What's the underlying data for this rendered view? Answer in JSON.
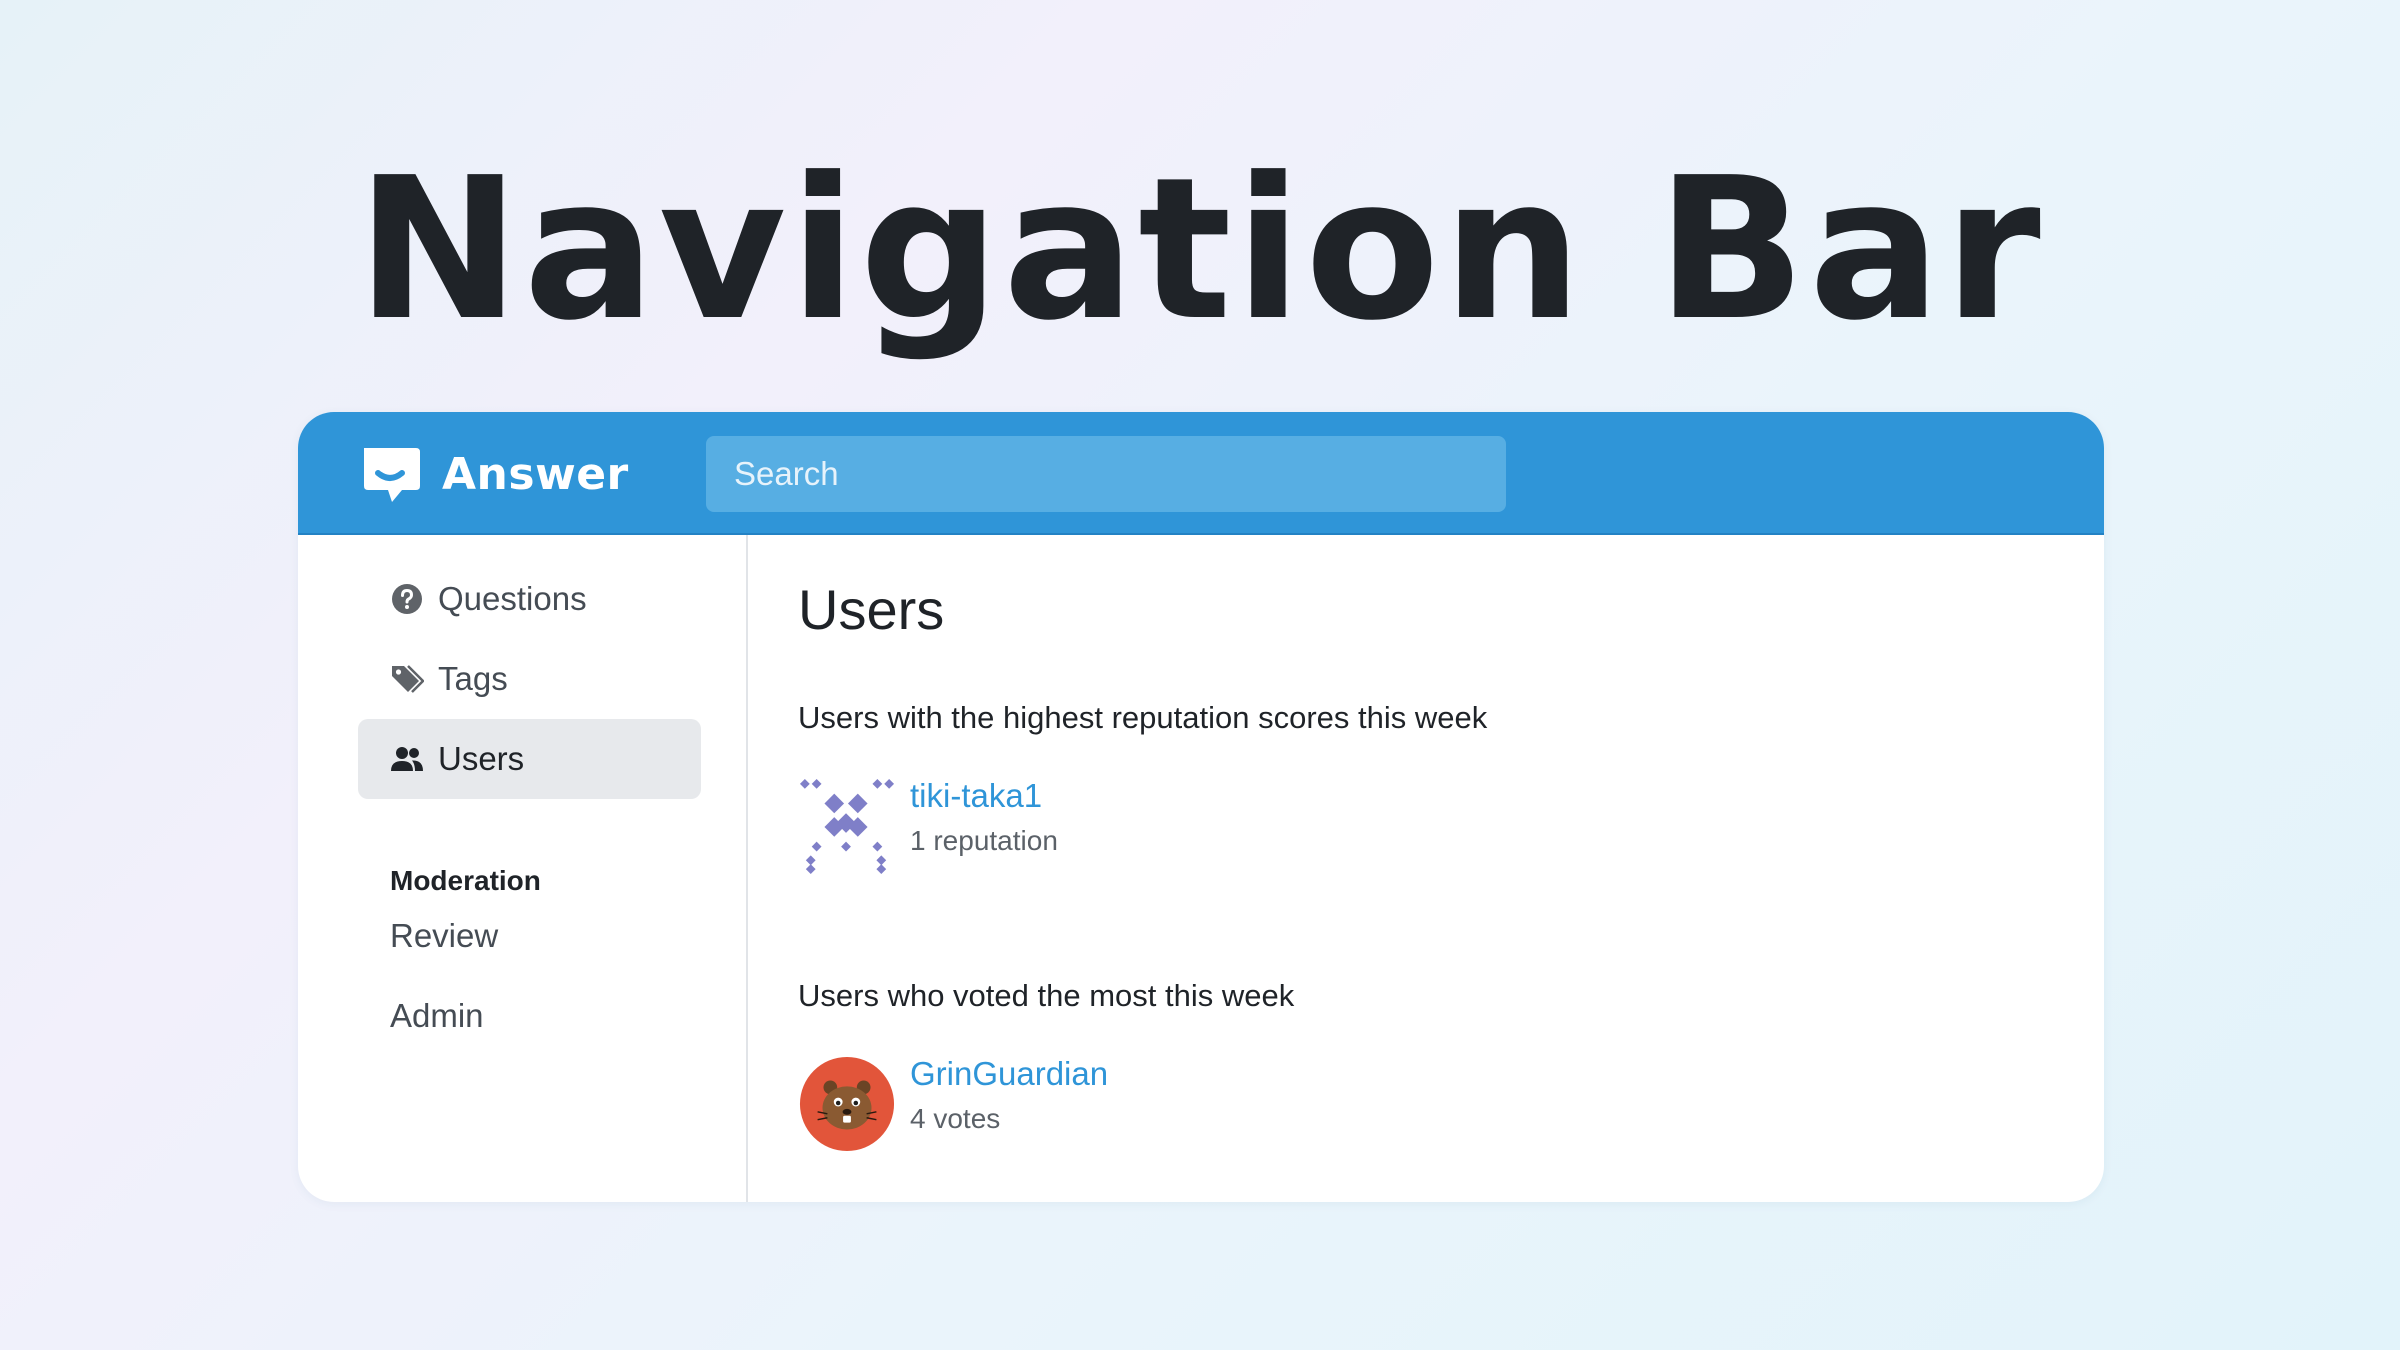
{
  "hero": {
    "title": "Navigation Bar"
  },
  "header": {
    "brand": "Answer",
    "search": {
      "placeholder": "Search",
      "value": ""
    },
    "accent": "#2f95d8"
  },
  "sidebar": {
    "items": [
      {
        "label": "Questions",
        "icon": "question-circle-icon",
        "active": false
      },
      {
        "label": "Tags",
        "icon": "tag-icon",
        "active": false
      },
      {
        "label": "Users",
        "icon": "users-icon",
        "active": true
      }
    ],
    "moderation": {
      "heading": "Moderation",
      "items": [
        {
          "label": "Review"
        },
        {
          "label": "Admin"
        }
      ]
    }
  },
  "main": {
    "title": "Users",
    "reputation_section": {
      "heading": "Users with the highest reputation scores this week",
      "users": [
        {
          "name": "tiki-taka1",
          "meta": "1 reputation",
          "avatar": "identicon-avatar"
        }
      ]
    },
    "votes_section": {
      "heading": "Users who voted the most this week",
      "users": [
        {
          "name": "GrinGuardian",
          "meta": "4 votes",
          "avatar": "beaver-avatar"
        }
      ]
    }
  }
}
